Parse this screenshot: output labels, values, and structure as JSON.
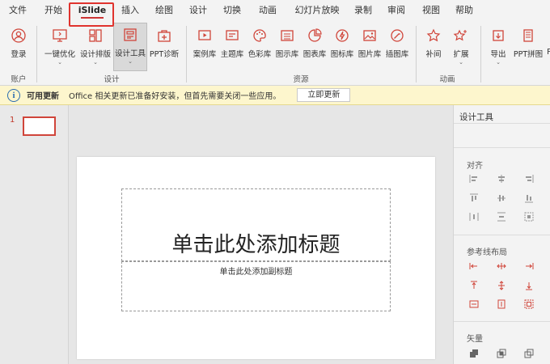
{
  "menubar": {
    "items": [
      "文件",
      "开始",
      "iSlide",
      "插入",
      "绘图",
      "设计",
      "切换",
      "动画",
      "幻灯片放映",
      "录制",
      "审阅",
      "视图",
      "帮助"
    ],
    "active": "iSlide"
  },
  "ribbon": {
    "buttons": {
      "login": "登录",
      "one_click": "一键优化",
      "design_layout": "设计排版",
      "design_tools": "设计工具",
      "ppt_diag": "PPT诊断",
      "case_lib": "案例库",
      "theme_lib": "主题库",
      "color_lib": "色彩库",
      "diagram_lib": "图示库",
      "chart_lib": "图表库",
      "icon_lib": "图标库",
      "picture_lib": "图片库",
      "illustration_lib": "插图库",
      "tween": "补间",
      "extend": "扩展",
      "export": "导出",
      "ppt_collage": "PPT拼图",
      "more": "P"
    },
    "groups": {
      "account": "账户",
      "design": "设计",
      "resources": "资源",
      "animation": "动画"
    }
  },
  "notification": {
    "title": "可用更新",
    "message": "Office 相关更新已准备好安装，但首先需要关闭一些应用。",
    "button": "立即更新"
  },
  "thumbnails": {
    "slide_number": "1"
  },
  "slide": {
    "title_placeholder": "单击此处添加标题",
    "subtitle_placeholder": "单击此处添加副标题"
  },
  "panel": {
    "title": "设计工具",
    "sections": {
      "align": "对齐",
      "guides": "参考线布局",
      "vector": "矢量"
    }
  },
  "colors": {
    "accent": "#d0453a",
    "notification_bg": "#fdf6cd",
    "info_blue": "#2b6cb0"
  }
}
